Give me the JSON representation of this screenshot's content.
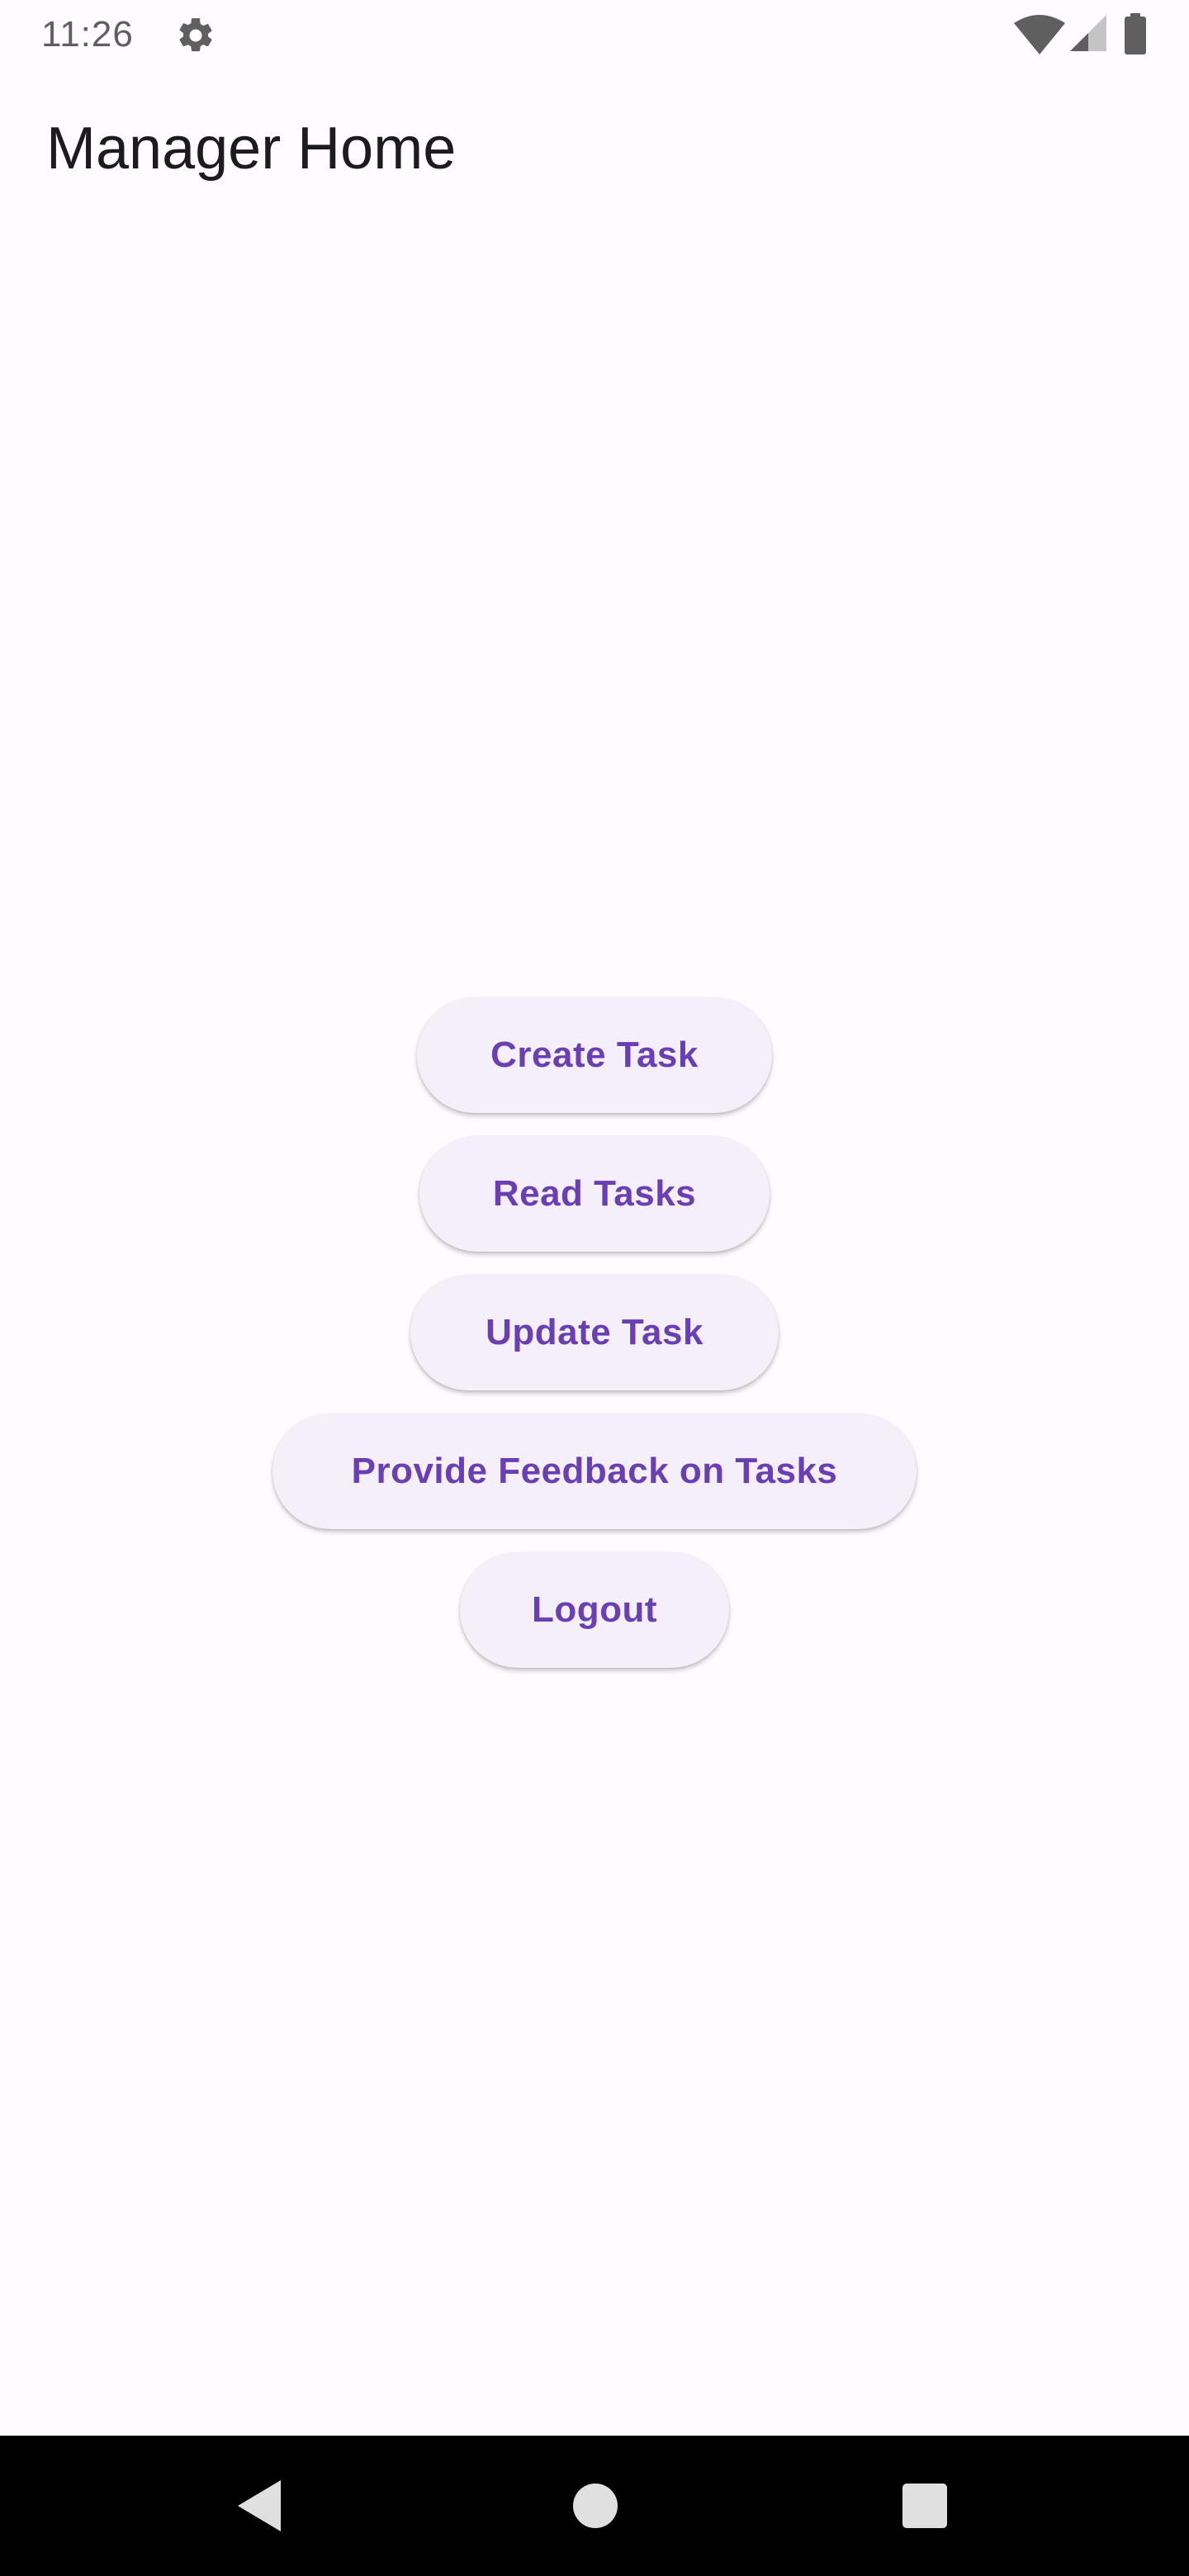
{
  "status_bar": {
    "time": "11:26",
    "icons": [
      "gear-icon",
      "wifi-icon",
      "cellular-signal-icon",
      "battery-icon"
    ]
  },
  "app_bar": {
    "title": "Manager Home"
  },
  "buttons": {
    "create_task": "Create Task",
    "read_tasks": "Read Tasks",
    "update_task": "Update Task",
    "provide_feedback": "Provide Feedback on Tasks",
    "logout": "Logout"
  },
  "navigation_bar": {
    "icons": [
      "back-icon",
      "home-icon",
      "recents-icon"
    ]
  },
  "colors": {
    "background": "#fffbfe",
    "button_background": "#f4eff8",
    "button_text": "#6a3fb5",
    "title_text": "#1c1b1f",
    "status_text": "#5f5f5f",
    "nav_bar": "#000000"
  }
}
